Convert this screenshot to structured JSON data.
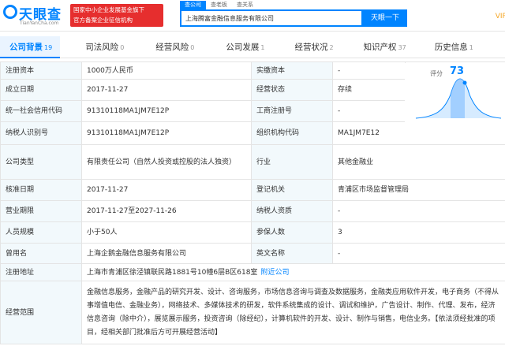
{
  "header": {
    "logo_cn": "天眼查",
    "logo_en": "TianYanCha.com",
    "banner_line1": "国家中小企业发展基金旗下",
    "banner_line2": "官方备案企业征信机构",
    "search_tabs": [
      "查公司",
      "查老板",
      "查关系"
    ],
    "search_value": "上海腾富金融信息服务有限公司",
    "search_button": "天眼一下",
    "vip": "VIP"
  },
  "tabs": [
    {
      "label": "公司背景",
      "count": "19"
    },
    {
      "label": "司法风险",
      "count": "0"
    },
    {
      "label": "经营风险",
      "count": "0"
    },
    {
      "label": "公司发展",
      "count": "1"
    },
    {
      "label": "经营状况",
      "count": "2"
    },
    {
      "label": "知识产权",
      "count": "37"
    },
    {
      "label": "历史信息",
      "count": "1"
    }
  ],
  "score": {
    "label": "评分",
    "value": "73"
  },
  "rows": {
    "r1": {
      "l1": "注册资本",
      "v1": "1000万人民币",
      "l2": "实缴资本",
      "v2": "-"
    },
    "r2": {
      "l1": "成立日期",
      "v1": "2017-11-27",
      "l2": "经营状态",
      "v2": "存续"
    },
    "r3": {
      "l1": "统一社会信用代码",
      "v1": "91310118MA1JM7E12P",
      "l2": "工商注册号",
      "v2": "-"
    },
    "r4": {
      "l1": "纳税人识别号",
      "v1": "91310118MA1JM7E12P",
      "l2": "组织机构代码",
      "v2": "MA1JM7E12"
    },
    "r5": {
      "l1": "公司类型",
      "v1": "有限责任公司（自然人投资或控股的法人独资）",
      "l2": "行业",
      "v2": "其他金融业"
    },
    "r6": {
      "l1": "核准日期",
      "v1": "2017-11-27",
      "l2": "登记机关",
      "v2": "青浦区市场监督管理局"
    },
    "r7": {
      "l1": "营业期限",
      "v1": "2017-11-27至2027-11-26",
      "l2": "纳税人资质",
      "v2": "-"
    },
    "r8": {
      "l1": "人员规模",
      "v1": "小于50人",
      "l2": "参保人数",
      "v2": "3"
    },
    "r9": {
      "l1": "曾用名",
      "v1": "上海企鹅金融信息服务有限公司",
      "l2": "英文名称",
      "v2": "-"
    },
    "r10": {
      "l1": "注册地址",
      "v1": "上海市青浦区徐泾镇联民路1881号10幢6层B区618室",
      "link": "附近公司"
    },
    "r11": {
      "l1": "经营范围",
      "v1": "金融信息服务，金融产品的研究开发、设计、咨询服务，市场信息咨询与调查及数据服务，金融类应用软件开发，电子商务（不得从事增值电信、金融业务），网络技术、多媒体技术的研发，软件系统集成的设计、调试和维护，广告设计、制作、代理、发布，经济信息咨询（除中介），展览展示服务，投资咨询（除经纪），计算机软件的开发、设计、制作与销售，电信业务。【依法须经批准的项目，经相关部门批准后方可开展经营活动】"
    }
  }
}
